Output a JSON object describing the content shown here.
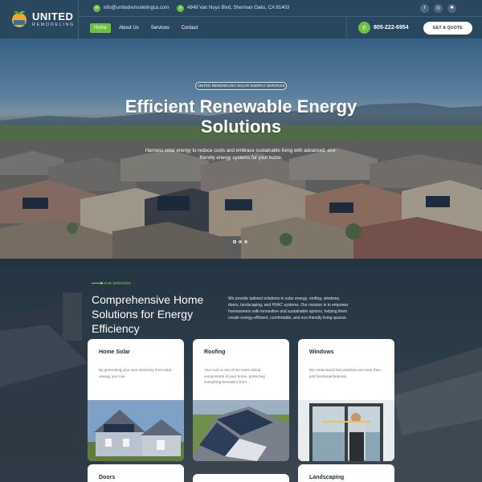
{
  "brand": {
    "line1": "UNITED",
    "line2": "REMODELING"
  },
  "topbar": {
    "email": "info@unitedremodelingca.com",
    "address": "4849 Van Nuys Blvd, Sherman Oaks, CA 91403",
    "social_icons": [
      "facebook-icon",
      "instagram-icon",
      "yelp-icon"
    ]
  },
  "nav": {
    "items": [
      "Home",
      "About Us",
      "Services",
      "Contact"
    ],
    "phone": "805-222-6954",
    "quote_label": "GET A QUOTE"
  },
  "hero": {
    "badge": "UNITED REMODELING SOLAR ENERGY SERVICES",
    "title": "Efficient Renewable Energy Solutions",
    "subtitle": "Harness solar energy to reduce costs and embrace sustainable living with advanced, eco-friendly energy systems for your home.",
    "active_slide": 1,
    "slide_count": 3
  },
  "services": {
    "eyebrow": "OUR SERVICES",
    "title": "Comprehensive Home Solutions for Energy Efficiency",
    "description": "We provide tailored solutions in solar energy, roofing, windows, doors, landscaping, and HVAC systems. Our mission is to empower homeowners with innovative and sustainable options, helping them create energy-efficient, comfortable, and eco-friendly living spaces.",
    "cards": [
      {
        "title": "Home Solar",
        "text": "By generating your own electricity from solar energy, you can."
      },
      {
        "title": "Roofing",
        "text": "Your roof is one of the most critical components of your home, protecting everything beneath it from..."
      },
      {
        "title": "Windows",
        "text": "We understand that windows are more than just functional features"
      },
      {
        "title": "Doors",
        "text": ""
      },
      {
        "title": "",
        "text": ""
      },
      {
        "title": "Landscaping",
        "text": ""
      }
    ]
  },
  "colors": {
    "accent": "#6cbf3f",
    "header_bg": "#2a4760",
    "dark_bg": "#243442"
  }
}
